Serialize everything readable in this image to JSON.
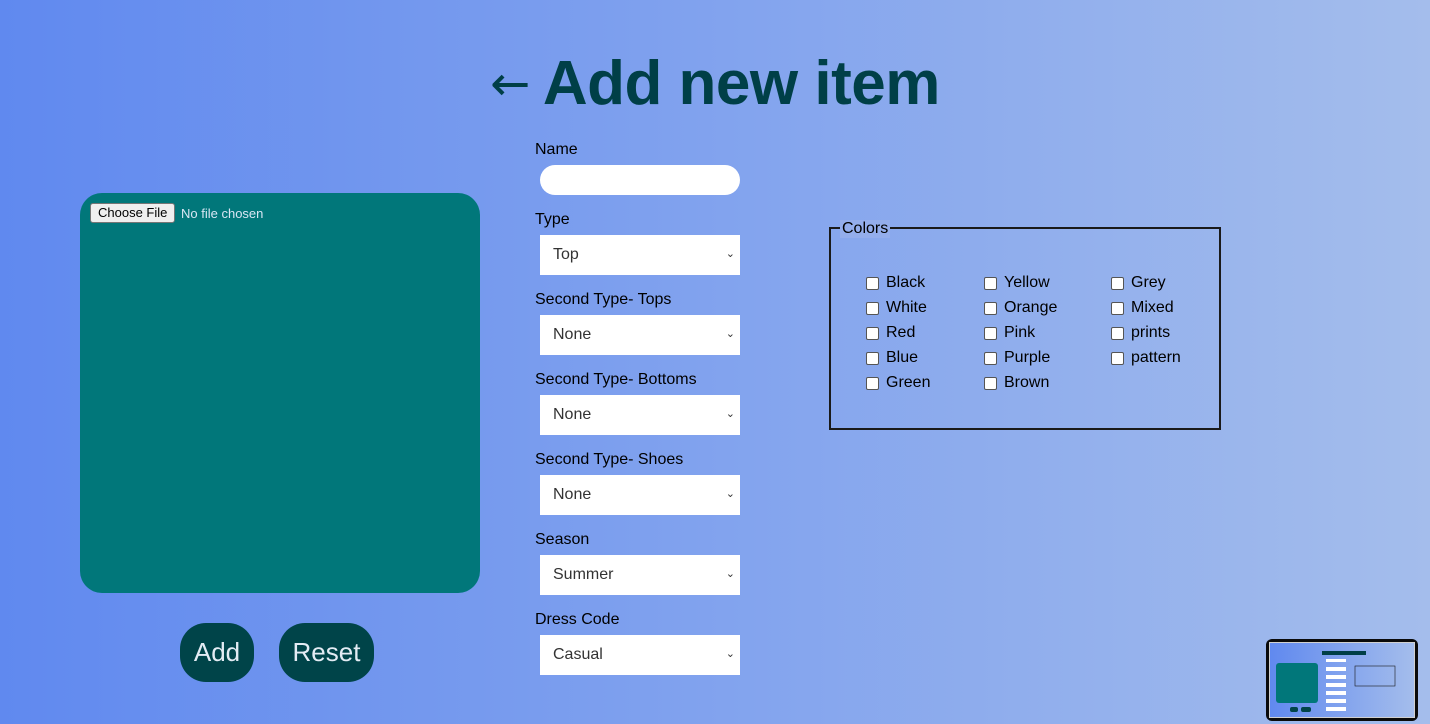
{
  "header": {
    "back_icon": "arrow-left-icon",
    "back_glyph": "←",
    "title": "Add new item"
  },
  "upload": {
    "choose_file_label": "Choose File",
    "file_status": "No file chosen"
  },
  "buttons": {
    "add_label": "Add",
    "reset_label": "Reset"
  },
  "form": {
    "name_label": "Name",
    "name_value": "",
    "type_label": "Type",
    "type_value": "Top",
    "second_type_tops_label": "Second Type- Tops",
    "second_type_tops_value": "None",
    "second_type_bottoms_label": "Second Type- Bottoms",
    "second_type_bottoms_value": "None",
    "second_type_shoes_label": "Second Type- Shoes",
    "second_type_shoes_value": "None",
    "season_label": "Season",
    "season_value": "Summer",
    "dress_code_label": "Dress Code",
    "dress_code_value": "Casual"
  },
  "colors": {
    "legend": "Colors",
    "col1": [
      "Black",
      "White",
      "Red",
      "Blue",
      "Green"
    ],
    "col2": [
      "Yellow",
      "Orange",
      "Pink",
      "Purple",
      "Brown"
    ],
    "col3": [
      "Grey",
      "Mixed",
      "prints",
      "pattern"
    ]
  },
  "theme": {
    "accent": "#01777a",
    "title_color": "#003f47",
    "button_bg": "#004449"
  }
}
